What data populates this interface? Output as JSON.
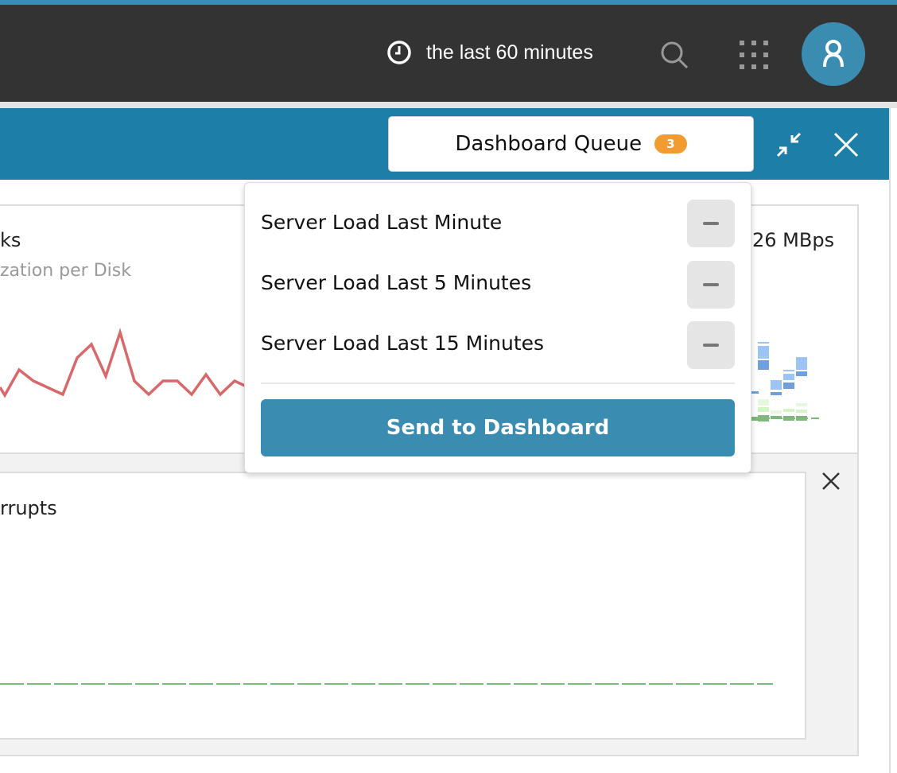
{
  "header": {
    "time_range": "the last 60 minutes",
    "icons": [
      "clock-icon",
      "search-icon",
      "apps-grid-icon",
      "user-icon"
    ]
  },
  "panel_bar": {
    "queue_label": "Dashboard Queue",
    "queue_count": "3",
    "icons": [
      "collapse-icon",
      "close-icon"
    ]
  },
  "queue": {
    "items": [
      {
        "label": "Server Load Last Minute"
      },
      {
        "label": "Server Load Last 5 Minutes"
      },
      {
        "label": "Server Load Last 15 Minutes"
      }
    ],
    "send_label": "Send to Dashboard"
  },
  "widgets": [
    {
      "title": "ks",
      "subtitle": "zation per Disk",
      "value": "26 MBps"
    },
    {
      "title": "rrupts"
    }
  ],
  "colors": {
    "accent": "#1d7fa8",
    "button": "#3a8db0",
    "badge": "#f29b30",
    "line": "#d9686a",
    "header": "#333333"
  }
}
